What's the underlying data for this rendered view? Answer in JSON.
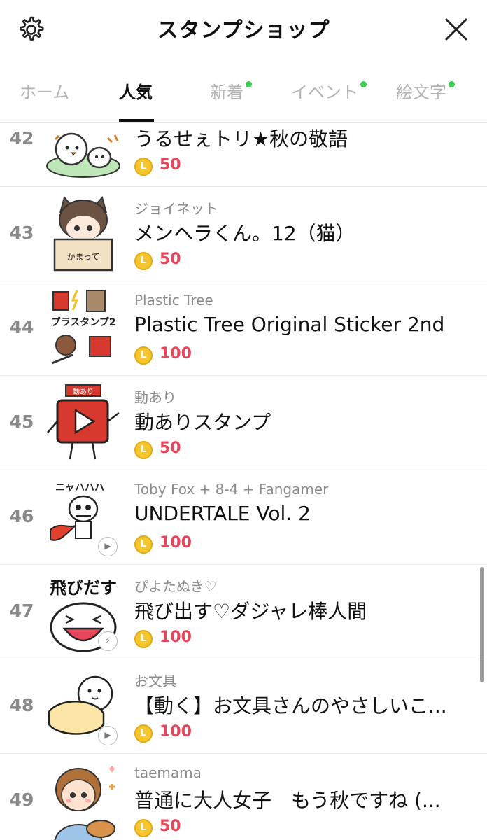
{
  "header": {
    "title": "スタンプショップ"
  },
  "tabs": [
    {
      "label": "ホーム",
      "active": false,
      "dot": false
    },
    {
      "label": "人気",
      "active": true,
      "dot": false
    },
    {
      "label": "新着",
      "active": false,
      "dot": true
    },
    {
      "label": "イベント",
      "active": false,
      "dot": true
    },
    {
      "label": "絵文字",
      "active": false,
      "dot": true
    }
  ],
  "coin_letter": "L",
  "items": [
    {
      "rank": "42",
      "author": "",
      "name": "うるせぇトリ★秋の敬語",
      "price": "50",
      "badge": ""
    },
    {
      "rank": "43",
      "author": "ジョイネット",
      "name": "メンヘラくん。12（猫）",
      "price": "50",
      "badge": ""
    },
    {
      "rank": "44",
      "author": "Plastic Tree",
      "name": "Plastic Tree Original Sticker 2nd",
      "price": "100",
      "badge": ""
    },
    {
      "rank": "45",
      "author": "動あり",
      "name": "動ありスタンプ",
      "price": "50",
      "badge": ""
    },
    {
      "rank": "46",
      "author": "Toby Fox + 8-4 + Fangamer",
      "name": "UNDERTALE Vol. 2",
      "price": "100",
      "badge": "play"
    },
    {
      "rank": "47",
      "author": "ぴよたぬき♡",
      "name": "飛び出す♡ダジャレ棒人間",
      "price": "100",
      "badge": "bolt"
    },
    {
      "rank": "48",
      "author": "お文具",
      "name": "【動く】お文具さんのやさしいこ...",
      "price": "100",
      "badge": "play"
    },
    {
      "rank": "49",
      "author": "taemama",
      "name": "普通に大人女子　もう秋ですね (...",
      "price": "50",
      "badge": ""
    }
  ],
  "thumb_text": {
    "t44": "プラスタンプ2",
    "t45": "動あり",
    "t46": "ニャハハハ",
    "t47": "飛びだす",
    "t43": "かまって"
  }
}
